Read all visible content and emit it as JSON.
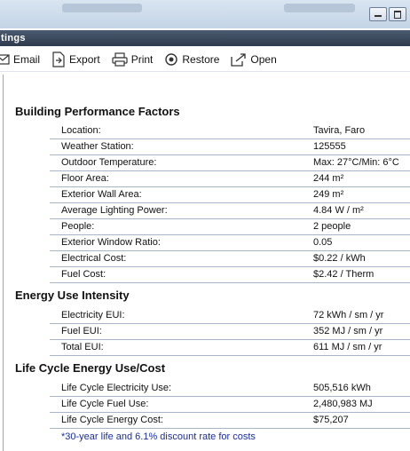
{
  "window": {
    "title_fragment": "tings"
  },
  "toolbar": {
    "email": "Email",
    "export": "Export",
    "print": "Print",
    "restore": "Restore",
    "open": "Open"
  },
  "sections": {
    "bpf": {
      "title": "Building Performance Factors",
      "rows": [
        {
          "label": "Location:",
          "value": "Tavira, Faro"
        },
        {
          "label": "Weather Station:",
          "value": "125555"
        },
        {
          "label": "Outdoor Temperature:",
          "value": "Max: 27°C/Min: 6°C"
        },
        {
          "label": "Floor Area:",
          "value": "244 m²"
        },
        {
          "label": "Exterior Wall Area:",
          "value": "249 m²"
        },
        {
          "label": "Average Lighting Power:",
          "value": "4.84 W / m²"
        },
        {
          "label": "People:",
          "value": "2 people"
        },
        {
          "label": "Exterior Window Ratio:",
          "value": "0.05"
        },
        {
          "label": "Electrical Cost:",
          "value": "$0.22 / kWh"
        },
        {
          "label": "Fuel Cost:",
          "value": "$2.42 / Therm"
        }
      ]
    },
    "eui": {
      "title": "Energy Use Intensity",
      "rows": [
        {
          "label": "Electricity EUI:",
          "value": "72 kWh / sm / yr"
        },
        {
          "label": "Fuel EUI:",
          "value": "352 MJ / sm / yr"
        },
        {
          "label": "Total EUI:",
          "value": "611 MJ / sm / yr"
        }
      ]
    },
    "lce": {
      "title": "Life Cycle Energy Use/Cost",
      "rows": [
        {
          "label": "Life Cycle Electricity Use:",
          "value": "505,516 kWh"
        },
        {
          "label": "Life Cycle Fuel Use:",
          "value": "2,480,983 MJ"
        },
        {
          "label": "Life Cycle Energy Cost:",
          "value": "$75,207"
        }
      ],
      "note": "*30-year life and 6.1% discount rate for costs"
    }
  }
}
